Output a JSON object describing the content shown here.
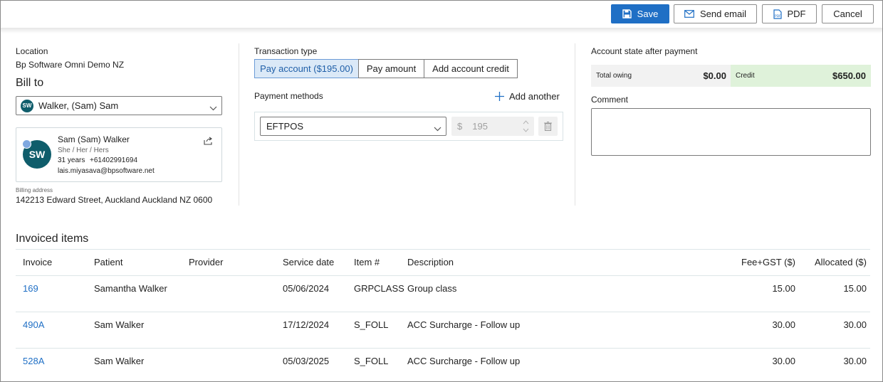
{
  "toolbar": {
    "save_label": "Save",
    "send_email_label": "Send email",
    "pdf_label": "PDF",
    "cancel_label": "Cancel"
  },
  "left": {
    "location_label": "Location",
    "location_value": "Bp Software Omni Demo NZ",
    "bill_to_label": "Bill to",
    "bill_to_initials": "SW",
    "bill_to_value": "Walker, (Sam) Sam",
    "patient": {
      "initials": "SW",
      "name": "Sam (Sam) Walker",
      "pronouns": "She / Her / Hers",
      "age": "31 years",
      "phone": "+61402991694",
      "email": "lais.miyasava@bpsoftware.net"
    },
    "billing_address_label": "Billing address",
    "billing_address_value": "142213 Edward Street, Auckland Auckland NZ 0600"
  },
  "middle": {
    "transaction_type_label": "Transaction type",
    "segments": [
      "Pay account ($195.00)",
      "Pay amount",
      "Add account credit"
    ],
    "payment_methods_label": "Payment methods",
    "add_another_label": "Add another",
    "method_value": "EFTPOS",
    "currency_symbol": "$",
    "amount_value": "195"
  },
  "right": {
    "account_state_label": "Account state after payment",
    "total_owing_label": "Total owing",
    "total_owing_value": "$0.00",
    "credit_label": "Credit",
    "credit_value": "$650.00",
    "comment_label": "Comment"
  },
  "table": {
    "title": "Invoiced items",
    "headers": {
      "invoice": "Invoice",
      "patient": "Patient",
      "provider": "Provider",
      "service_date": "Service date",
      "item": "Item #",
      "description": "Description",
      "fee": "Fee+GST ($)",
      "allocated": "Allocated ($)"
    },
    "rows": [
      {
        "invoice": "169",
        "patient": "Samantha Walker",
        "provider": "",
        "service_date": "05/06/2024",
        "item": "GRPCLASS",
        "description": "Group class",
        "fee": "15.00",
        "allocated": "15.00"
      },
      {
        "invoice": "490A",
        "patient": "Sam Walker",
        "provider": "",
        "service_date": "17/12/2024",
        "item": "S_FOLL",
        "description": "ACC Surcharge - Follow up",
        "fee": "30.00",
        "allocated": "30.00"
      },
      {
        "invoice": "528A",
        "patient": "Sam Walker",
        "provider": "",
        "service_date": "05/03/2025",
        "item": "S_FOLL",
        "description": "ACC Surcharge - Follow up",
        "fee": "30.00",
        "allocated": "30.00"
      }
    ]
  },
  "colors": {
    "primary": "#1f6fc5",
    "avatar": "#0f5d6b",
    "credit_bg": "#dff2da",
    "owing_bg": "#f2f2f2",
    "active_segment_bg": "#dbe9f7"
  }
}
